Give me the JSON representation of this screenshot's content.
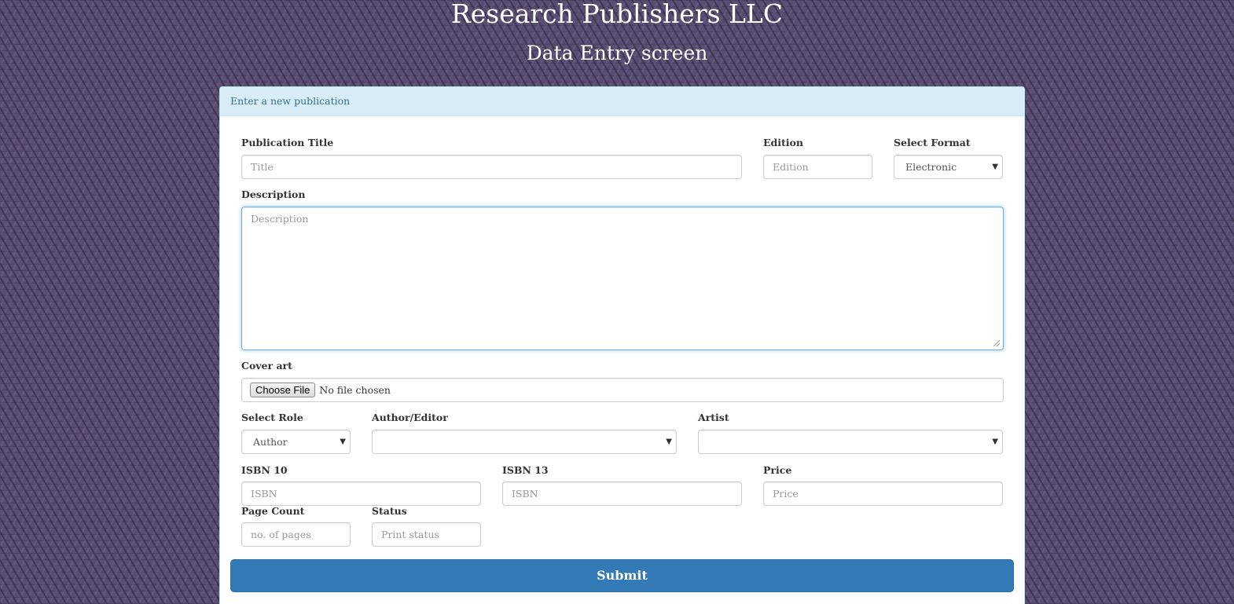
{
  "header": {
    "site_title": "Research Publishers LLC",
    "screen_title": "Data Entry screen"
  },
  "panel": {
    "heading": "Enter a new publication"
  },
  "form": {
    "title": {
      "label": "Publication Title",
      "placeholder": "Title",
      "value": ""
    },
    "edition": {
      "label": "Edition",
      "placeholder": "Edition",
      "value": ""
    },
    "format": {
      "label": "Select Format",
      "selected": "Electronic"
    },
    "description": {
      "label": "Description",
      "placeholder": "Description",
      "value": ""
    },
    "cover_art": {
      "label": "Cover art",
      "button": "Choose File",
      "status": "No file chosen"
    },
    "role": {
      "label": "Select Role",
      "selected": "Author"
    },
    "author_editor": {
      "label": "Author/Editor",
      "selected": ""
    },
    "artist": {
      "label": "Artist",
      "selected": ""
    },
    "isbn10": {
      "label": "ISBN 10",
      "placeholder": "ISBN",
      "value": ""
    },
    "isbn13": {
      "label": "ISBN 13",
      "placeholder": "ISBN",
      "value": ""
    },
    "price": {
      "label": "Price",
      "placeholder": "Price",
      "value": ""
    },
    "page_count": {
      "label": "Page Count",
      "placeholder": "no. of pages",
      "value": ""
    },
    "status": {
      "label": "Status",
      "placeholder": "Print status",
      "value": ""
    },
    "submit_label": "Submit"
  },
  "icons": {
    "select_caret": "chevron-down-icon",
    "textarea_resize": "resize-grip-icon"
  },
  "colors": {
    "panel_heading_bg": "#d9edf7",
    "panel_heading_text": "#31708f",
    "submit_bg": "#337ab7",
    "focus_border": "#66afe9"
  }
}
